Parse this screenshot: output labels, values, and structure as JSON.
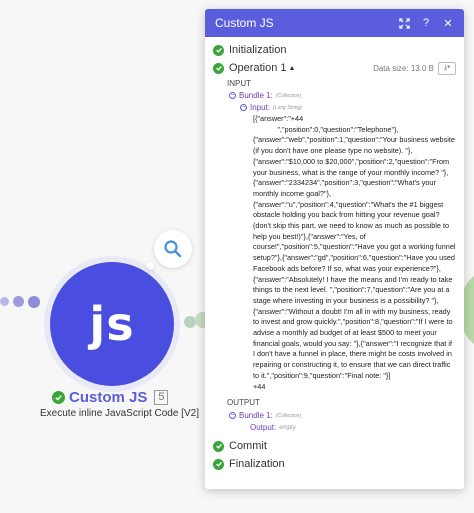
{
  "canvas": {
    "module": {
      "icon_text": "JS",
      "name": "Custom JS",
      "badge": "5",
      "subtitle": "Execute inline JavaScript Code [V2]"
    },
    "colors": {
      "module": "#4a4ee0",
      "success": "#3aa53a",
      "panel_header": "#5a5edd"
    }
  },
  "panel": {
    "title": "Custom JS",
    "header_icons": [
      "expand-icon",
      "help-icon",
      "close-icon"
    ],
    "steps": {
      "initialization": "Initialization",
      "commit": "Commit",
      "finalization": "Finalization"
    },
    "operation": {
      "label": "Operation 1",
      "data_size": "Data size: 13.0 B",
      "input_label": "INPUT",
      "output_label": "OUTPUT",
      "input_bundle": "Bundle 1:",
      "input_bundle_type": "(Collection)",
      "input_key": "Input:",
      "input_key_type": "(Long String)",
      "input_value": "[{\"answer\":\"+44\n            \",\"position\":0,\"question\":\"Telephone\"},{\"answer\":\"web\",\"position\":1,\"question\":\"Your business website (if you don't have one please type no website). \"},{\"answer\":\"$10,000 to $20,000\",\"position\":2,\"question\":\"From your business, what is the range of your monthly income? \"},{\"answer\":\"2334234\",\"position\":3,\"question\":\"What's your monthly income goal?\"},{\"answer\":\"u\",\"position\":4,\"question\":\"What's the #1 biggest obstacle holding you back from hitting your revenue goal? (don't skip this part, we need to know as much as possible to help you best!)\"},{\"answer\":\"Yes, of course!\",\"position\":5,\"question\":\"Have you got a working funnel setup?\"},{\"answer\":\"gd\",\"position\":6,\"question\":\"Have you used Facebook ads before? If so, what was your experience?\"},{\"answer\":\"Absolutely! I have the means and I'm ready to take things to the next level. \",\"position\":7,\"question\":\"Are you at a stage where investing in your business is a possibility? \"},{\"answer\":\"Without a doubt! I'm all in with my business, ready to invest and grow quickly.\",\"position\":8,\"question\":\"If I were to advise a monthly ad budget of at least $500 to meet your financial goals, would you say: \"},{\"answer\":\"I recognize that if I don't have a funnel in place, there might be costs involved in repairing or constructing it, to ensure that we can direct traffic to it.\",\"position\":9,\"question\":\"Final note: \"}]\n+44",
      "output_bundle": "Bundle 1:",
      "output_bundle_type": "(Collection)",
      "output_key": "Output:",
      "output_value": "empty"
    }
  }
}
